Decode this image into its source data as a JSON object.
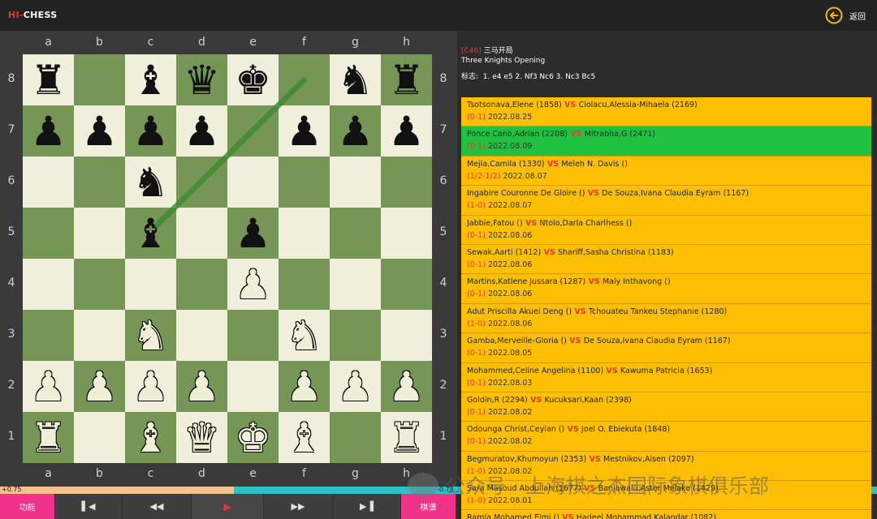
{
  "header": {
    "logo_hi": "HI",
    "logo_rest": "CHESS",
    "back_label": "返回"
  },
  "board": {
    "files": [
      "a",
      "b",
      "c",
      "d",
      "e",
      "f",
      "g",
      "h"
    ],
    "ranks": [
      "8",
      "7",
      "6",
      "5",
      "4",
      "3",
      "2",
      "1"
    ],
    "fen_rows": [
      "r.b.qk.nr",
      "ppppp.pp",
      "..n.....",
      "..b.p...",
      "....P...",
      "..N..N..",
      "PPPP.PPP",
      "R.BQKB.R"
    ],
    "pieces": [
      [
        "r",
        "",
        "b",
        "q",
        "k",
        "",
        "n",
        "r"
      ],
      [
        "p",
        "p",
        "p",
        "p",
        "",
        "p",
        "p",
        "p"
      ],
      [
        "",
        "",
        "n",
        "",
        "",
        "",
        "",
        ""
      ],
      [
        "",
        "",
        "b",
        "",
        "p",
        "",
        "",
        ""
      ],
      [
        "",
        "",
        "",
        "",
        "P",
        "",
        "",
        ""
      ],
      [
        "",
        "",
        "N",
        "",
        "",
        "N",
        "",
        ""
      ],
      [
        "P",
        "P",
        "P",
        "P",
        "",
        "P",
        "P",
        "P"
      ],
      [
        "R",
        "",
        "B",
        "Q",
        "K",
        "B",
        "",
        "R"
      ]
    ],
    "highlight_square": "c5",
    "arrow": {
      "from": "f8",
      "to": "c5",
      "color": "#3c8a2e"
    }
  },
  "eval": {
    "left_value": "+0.75",
    "right_value": "-0.75",
    "white_fraction": 0.267
  },
  "toolbar": {
    "function_label": "功能",
    "first_icon": "skip-first-icon",
    "prev_icon": "rewind-icon",
    "play_icon": "play-icon",
    "next_icon": "fast-forward-icon",
    "last_icon": "skip-last-icon",
    "manual_label": "棋谱"
  },
  "opening": {
    "code": "[C46]",
    "name_cn": "三马开局",
    "name_en": "Three Knights Opening",
    "moves_label": "标志:",
    "moves": "1. e4 e5 2. Nf3 Nc6 3. Nc3 Bc5"
  },
  "games": [
    {
      "white": "Tsotsonava,Elene (1858)",
      "black": "Ciolacu,Alessia-Mihaela (2169)",
      "result": "(0-1)",
      "date": "2022.08.25",
      "selected": false
    },
    {
      "white": "Ponce Cano,Adrian (2208)",
      "black": "Mitrabha,G (2471)",
      "result": "(0-1)",
      "date": "2022.08.09",
      "selected": true
    },
    {
      "white": "Mejia,Camila (1330)",
      "black": "Meleh N. Davis ()",
      "result": "(1/2-1/2)",
      "date": "2022.08.07",
      "selected": false
    },
    {
      "white": "Ingabire Couronne De Gloire ()",
      "black": "De Souza,Ivana Claudia Eyram (1167)",
      "result": "(1-0)",
      "date": "2022.08.07",
      "selected": false
    },
    {
      "white": "Jabbie,Fatou ()",
      "black": "Ntolo,Darla Charlhess ()",
      "result": "(0-1)",
      "date": "2022.08.06",
      "selected": false
    },
    {
      "white": "Sewak,Aarti (1412)",
      "black": "Shariff,Sasha Christina (1183)",
      "result": "(0-1)",
      "date": "2022.08.06",
      "selected": false
    },
    {
      "white": "Martins,Katlene Jussara (1287)",
      "black": "Maly Inthavong ()",
      "result": "(0-1)",
      "date": "2022.08.06",
      "selected": false
    },
    {
      "white": "Adut Priscilla Akuei Deng ()",
      "black": "Tchouateu Tankeu Stephanie (1280)",
      "result": "(1-0)",
      "date": "2022.08.06",
      "selected": false
    },
    {
      "white": "Gamba,Merveille-Gloria ()",
      "black": "De Souza,Ivana Claudia Eyram (1167)",
      "result": "(0-1)",
      "date": "2022.08.05",
      "selected": false
    },
    {
      "white": "Mohammed,Celine Angelina (1100)",
      "black": "Kawuma Patricia (1653)",
      "result": "(0-1)",
      "date": "2022.08.03",
      "selected": false
    },
    {
      "white": "Goldin,R (2294)",
      "black": "Kucuksari,Kaan (2398)",
      "result": "(0-1)",
      "date": "2022.08.02",
      "selected": false
    },
    {
      "white": "Odounga Christ,Ceylan ()",
      "black": "Joel O. Ebiekuta (1848)",
      "result": "(0-1)",
      "date": "2022.08.02",
      "selected": false
    },
    {
      "white": "Begmuratov,Khumoyun (2353)",
      "black": "Mestnikov,Aisen (2097)",
      "result": "(1-0)",
      "date": "2022.08.02",
      "selected": false
    },
    {
      "white": "Sara Masoud Abdullah (1677)",
      "black": "Banjawalu,Aster Melake (1429)",
      "result": "(1-0)",
      "date": "2022.08.01",
      "selected": false
    },
    {
      "white": "Ramla Mohamed Elmi ()",
      "black": "Hadeel Mohammad Kalandar (1082)",
      "result": "",
      "date": "",
      "selected": false
    }
  ],
  "vs_label": "VS",
  "watermark": "公众号 · 上海棋之杰国际象棋俱乐部",
  "colors": {
    "accent_red": "#e53935",
    "board_light": "#efefdc",
    "board_dark": "#769656",
    "list_bg": "#fcbf03",
    "selected_bg": "#20c140",
    "toolbar_pink": "#ee3388",
    "back_icon": "#f5b800"
  }
}
